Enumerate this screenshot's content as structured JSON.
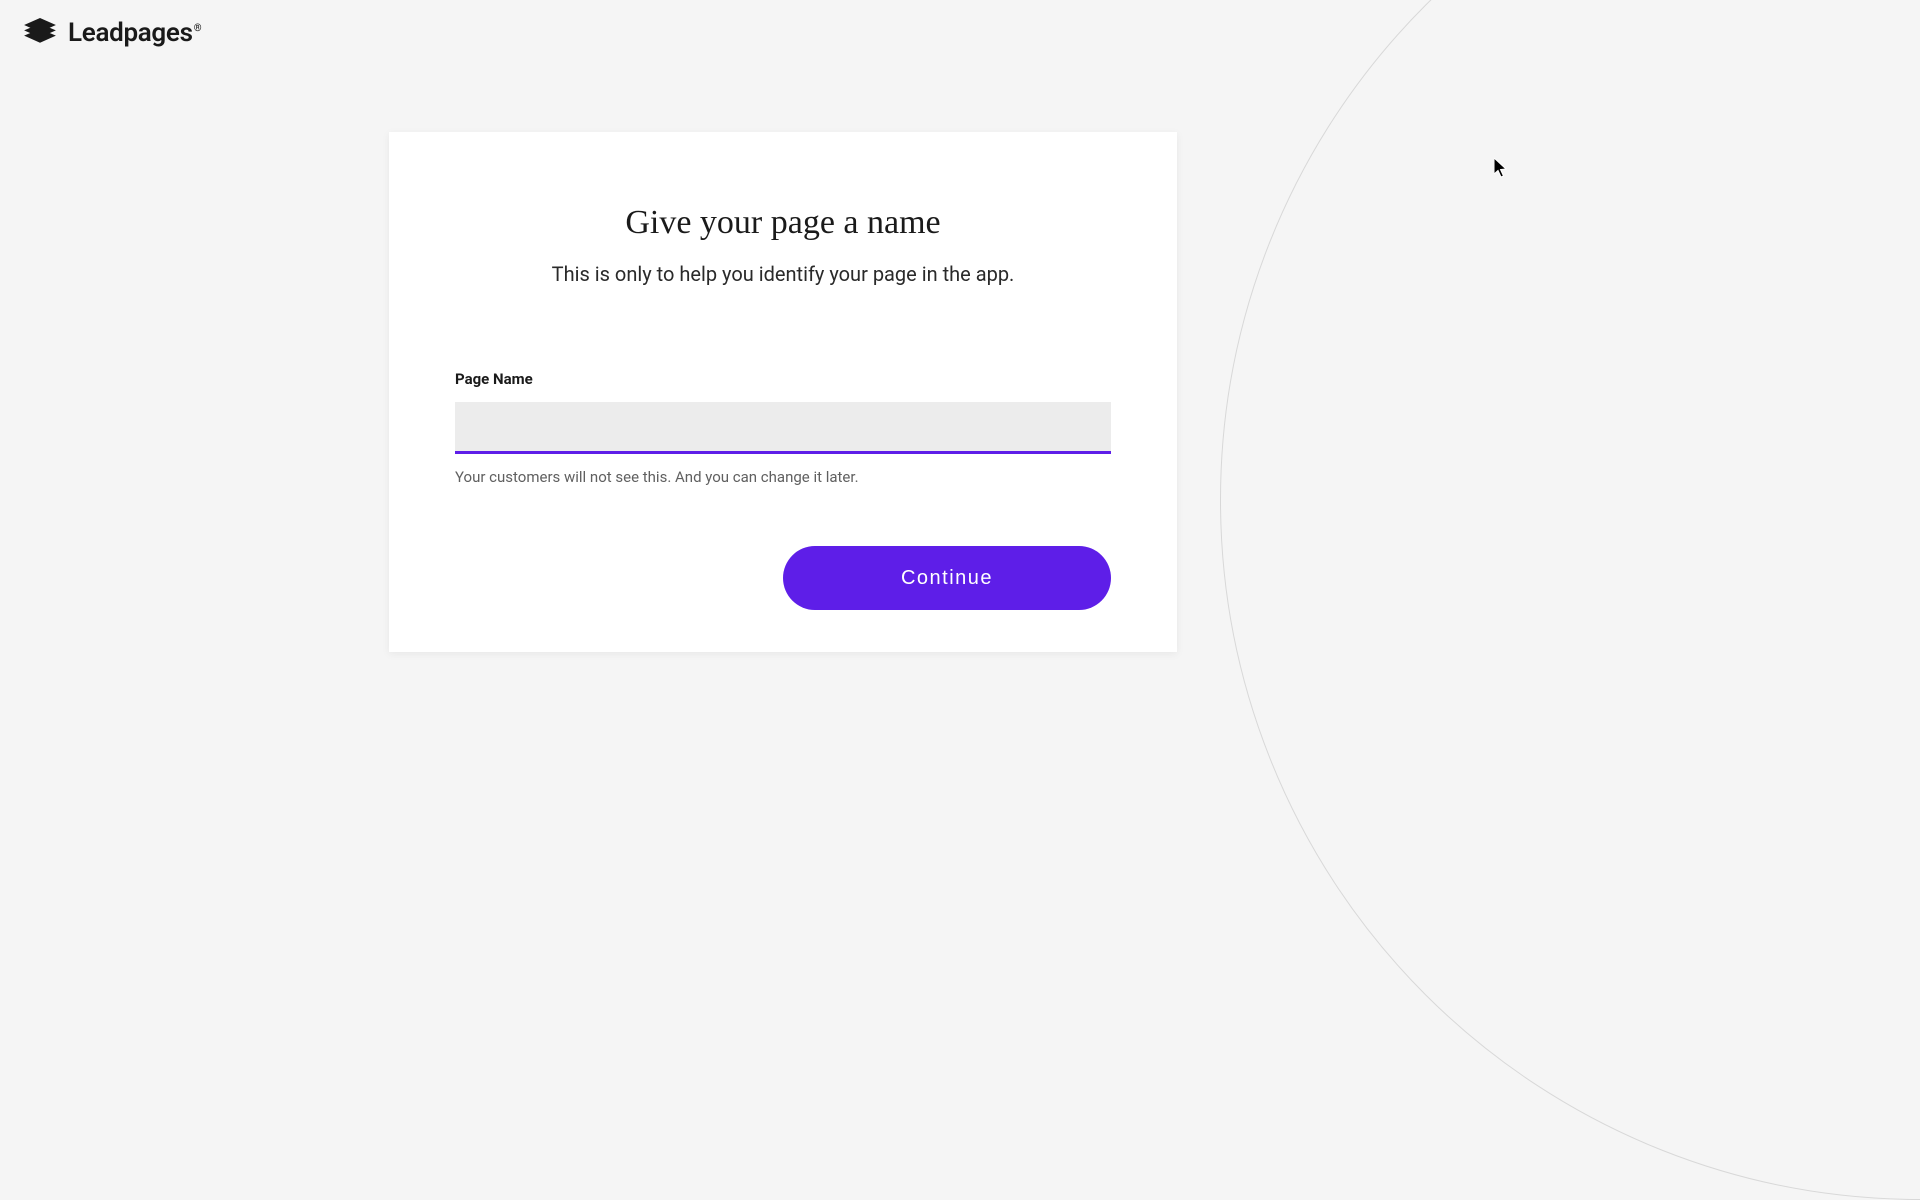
{
  "header": {
    "brand": "Leadpages"
  },
  "card": {
    "title": "Give your page a name",
    "subtitle": "This is only to help you identify your page in the app.",
    "form": {
      "label": "Page Name",
      "value": "",
      "helper": "Your customers will not see this. And you can change it later."
    },
    "actions": {
      "continue": "Continue"
    }
  }
}
